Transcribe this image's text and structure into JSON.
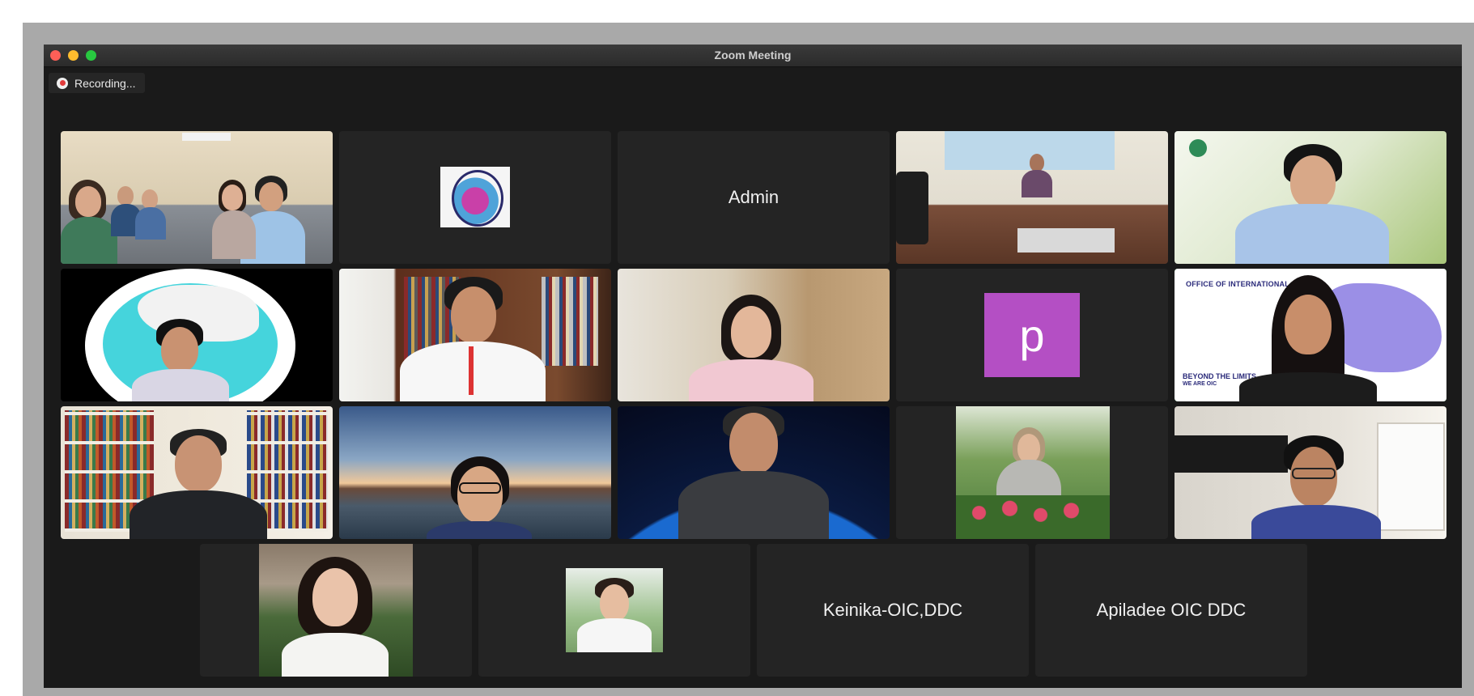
{
  "window": {
    "title": "Zoom Meeting"
  },
  "recording": {
    "label": "Recording..."
  },
  "participants": [
    {
      "type": "video",
      "scene": "conference room group"
    },
    {
      "type": "logo",
      "scene": "organization logo"
    },
    {
      "type": "name",
      "name": "Admin"
    },
    {
      "type": "video",
      "scene": "Public Health Emergency Operations Center (PHEOC)"
    },
    {
      "type": "video",
      "scene": "man green background"
    },
    {
      "type": "video",
      "scene": "man with map logo background"
    },
    {
      "type": "video",
      "scene": "man bookshelf"
    },
    {
      "type": "video",
      "scene": "woman blurred room"
    },
    {
      "type": "avatar",
      "initial": "p"
    },
    {
      "type": "video",
      "scene": "woman world map",
      "overlay_text": [
        "OFFICE OF INTERNATIONAL C",
        "BEYOND THE LIMITS",
        "WE ARE OIC"
      ]
    },
    {
      "type": "video",
      "scene": "man bookshelves"
    },
    {
      "type": "video",
      "scene": "woman lake background"
    },
    {
      "type": "video",
      "scene": "man earth background"
    },
    {
      "type": "photo",
      "scene": "woman with roses"
    },
    {
      "type": "video",
      "scene": "man home"
    },
    {
      "type": "photo",
      "scene": "woman portrait"
    },
    {
      "type": "photo",
      "scene": "young man portrait"
    },
    {
      "type": "name",
      "name": "Keinika-OIC,DDC"
    },
    {
      "type": "name",
      "name": "Apiladee OIC DDC"
    }
  ],
  "colors": {
    "active_speaker": "#2fbf4a",
    "avatar_p": "#b44fc4",
    "recording_dot": "#e03a3a"
  }
}
